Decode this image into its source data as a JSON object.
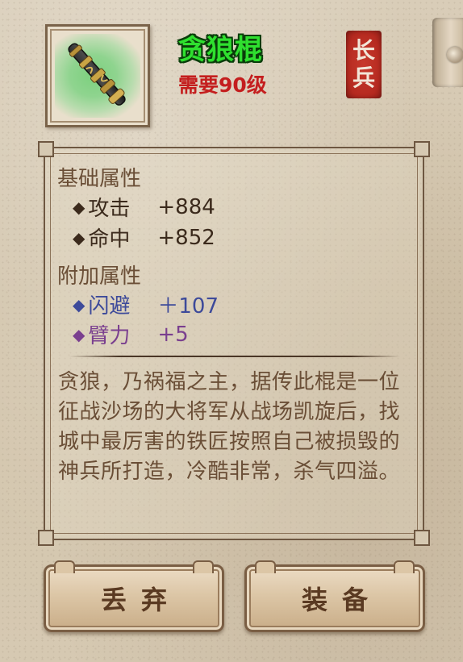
{
  "item": {
    "name": "贪狼棍",
    "level_requirement": "需要90级",
    "weapon_type_seal": [
      "长",
      "兵"
    ],
    "icon": "staff-weapon-icon"
  },
  "base_attributes": {
    "title": "基础属性",
    "stats": [
      {
        "bullet": "◆",
        "name": "攻击",
        "value": "+884",
        "color": "#3b2a1c"
      },
      {
        "bullet": "◆",
        "name": "命中",
        "value": "+852",
        "color": "#3b2a1c"
      }
    ]
  },
  "extra_attributes": {
    "title": "附加属性",
    "stats": [
      {
        "bullet": "◆",
        "name": "闪避",
        "value": "＋107",
        "color": "#3d4a9a"
      },
      {
        "bullet": "◆",
        "name": "臂力",
        "value": "+5",
        "color": "#7a3f8f"
      }
    ]
  },
  "description": "贪狼，乃祸福之主，据传此棍是一位征战沙场的大将军从战场凯旋后，找城中最厉害的铁匠按照自己被损毁的神兵所打造，冷酷非常，杀气四溢。",
  "buttons": {
    "discard": "丢弃",
    "equip": "装备"
  },
  "colors": {
    "name": "#2fe02f",
    "level_requirement": "#c41e1e",
    "section_title": "#6a4e36",
    "seal": "#b52a20"
  }
}
